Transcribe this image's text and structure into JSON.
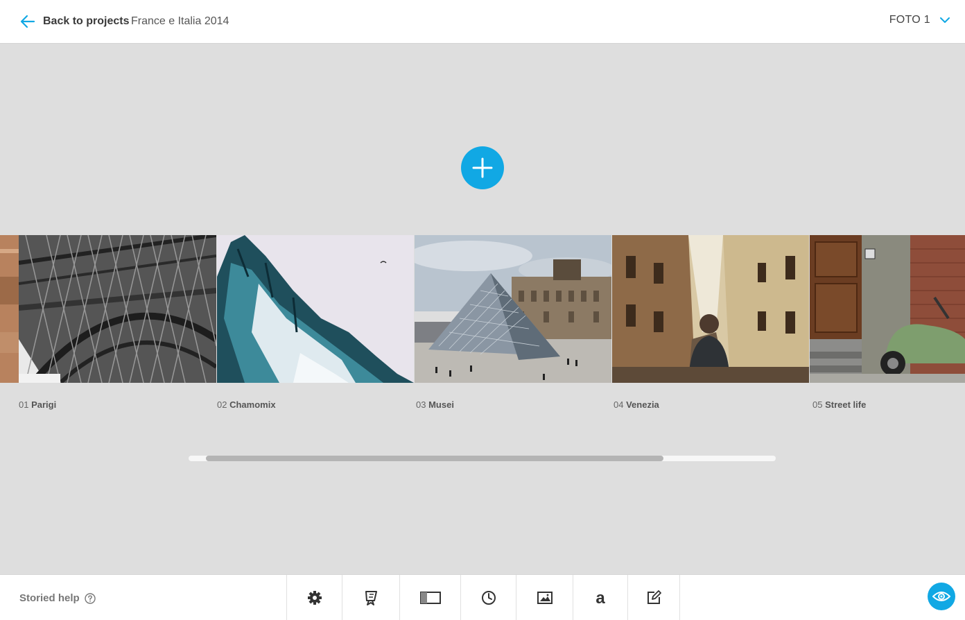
{
  "header": {
    "back_label": "Back to projects",
    "project_title": "France e Italia 2014",
    "version_label": "FOTO 1",
    "accent_color": "#11a8e4"
  },
  "add_button": {
    "icon": "plus-icon"
  },
  "slides": [
    {
      "number": "01",
      "title": "Parigi",
      "image": "eiffel-tower-photo"
    },
    {
      "number": "02",
      "title": "Chamomix",
      "image": "snowy-mountain-photo"
    },
    {
      "number": "03",
      "title": "Musei",
      "image": "louvre-pyramid-photo"
    },
    {
      "number": "04",
      "title": "Venezia",
      "image": "venice-alley-photo"
    },
    {
      "number": "05",
      "title": "Street life",
      "image": "green-scooter-photo"
    }
  ],
  "bottom": {
    "help_label": "Storied help",
    "tools": [
      {
        "icon": "gear-icon"
      },
      {
        "icon": "bookmark-flag-icon"
      },
      {
        "icon": "layout-panel-icon"
      },
      {
        "icon": "clock-icon"
      },
      {
        "icon": "image-icon"
      },
      {
        "icon": "font-a-icon"
      },
      {
        "icon": "edit-pencil-icon"
      }
    ],
    "preview_icon": "eye-icon"
  }
}
